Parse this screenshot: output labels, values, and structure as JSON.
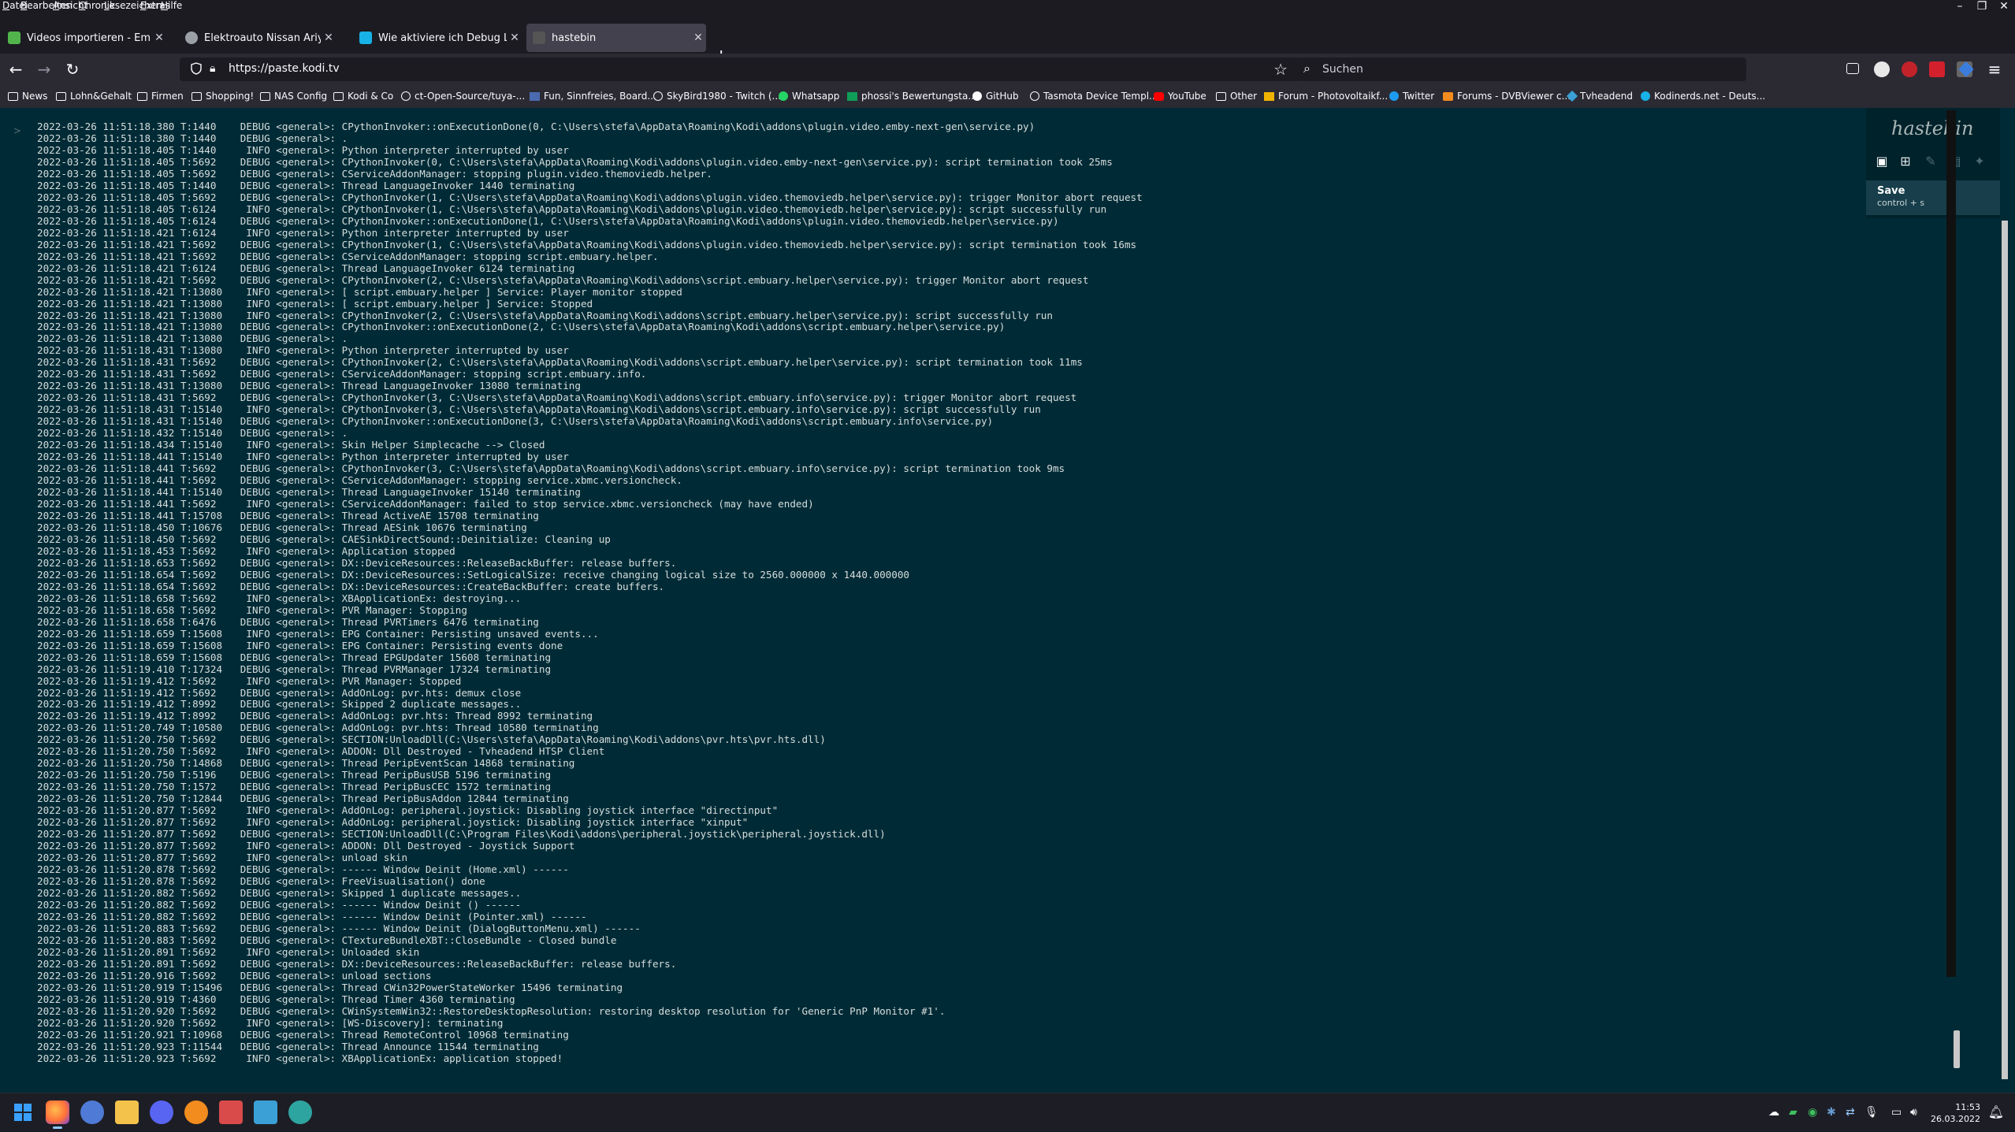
{
  "menubar": {
    "items": [
      "Datei",
      "Bearbeiten",
      "Ansicht",
      "Chronik",
      "Lesezeichen",
      "Extras",
      "Hilfe"
    ]
  },
  "tabs": [
    {
      "label": "Videos importieren - Emby in K...",
      "active": false,
      "icon": "emby-favicon",
      "color": "#52b54b"
    },
    {
      "label": "Elektroauto Nissan Ariya im erst...",
      "active": false,
      "icon": "globe-favicon",
      "color": "#9aa0a6"
    },
    {
      "label": "Wie aktiviere ich Debug Logging...",
      "active": false,
      "icon": "kodi-favicon",
      "color": "#17b2e7"
    },
    {
      "label": "hastebin",
      "active": true,
      "icon": "hastebin-favicon",
      "color": "#555"
    }
  ],
  "nav": {
    "url": "https://paste.kodi.tv",
    "search_placeholder": "Suchen"
  },
  "bookmarks": [
    {
      "label": "News",
      "icon": "folder-icon"
    },
    {
      "label": "Lohn&Gehalt",
      "icon": "folder-icon"
    },
    {
      "label": "Firmen",
      "icon": "folder-icon"
    },
    {
      "label": "Shopping!",
      "icon": "folder-icon"
    },
    {
      "label": "NAS Config",
      "icon": "folder-icon"
    },
    {
      "label": "Kodi & Co",
      "icon": "folder-icon"
    },
    {
      "label": "ct-Open-Source/tuya-...",
      "icon": "globe-icon"
    },
    {
      "label": "Fun, Sinnfreies, Board...",
      "icon": "site-icon"
    },
    {
      "label": "SkyBird1980 - Twitch (...",
      "icon": "globe-icon"
    },
    {
      "label": "Whatsapp",
      "icon": "whatsapp-icon"
    },
    {
      "label": "phossi's Bewertungsta...",
      "icon": "sheet-icon"
    },
    {
      "label": "GitHub",
      "icon": "github-icon"
    },
    {
      "label": "Tasmota Device Templ...",
      "icon": "globe-icon"
    },
    {
      "label": "YouTube",
      "icon": "youtube-icon"
    },
    {
      "label": "Other",
      "icon": "folder-icon"
    },
    {
      "label": "Forum - Photovoltaikf...",
      "icon": "site-icon"
    },
    {
      "label": "Twitter",
      "icon": "twitter-icon"
    },
    {
      "label": "Forums - DVBViewer c...",
      "icon": "rss-icon"
    },
    {
      "label": "Tvheadend",
      "icon": "site-icon"
    },
    {
      "label": "Kodinerds.net - Deuts...",
      "icon": "kodi-icon"
    }
  ],
  "hastebin": {
    "logo": "hastebin",
    "tooltip_title": "Save",
    "tooltip_shortcut": "control + s"
  },
  "gutter_marker": ">",
  "log_lines": [
    "2022-03-26 11:51:18.380 T:1440    DEBUG <general>: CPythonInvoker::onExecutionDone(0, C:\\Users\\stefa\\AppData\\Roaming\\Kodi\\addons\\plugin.video.emby-next-gen\\service.py)",
    "2022-03-26 11:51:18.380 T:1440    DEBUG <general>: .",
    "2022-03-26 11:51:18.405 T:1440     INFO <general>: Python interpreter interrupted by user",
    "2022-03-26 11:51:18.405 T:5692    DEBUG <general>: CPythonInvoker(0, C:\\Users\\stefa\\AppData\\Roaming\\Kodi\\addons\\plugin.video.emby-next-gen\\service.py): script termination took 25ms",
    "2022-03-26 11:51:18.405 T:5692    DEBUG <general>: CServiceAddonManager: stopping plugin.video.themoviedb.helper.",
    "2022-03-26 11:51:18.405 T:1440    DEBUG <general>: Thread LanguageInvoker 1440 terminating",
    "2022-03-26 11:51:18.405 T:5692    DEBUG <general>: CPythonInvoker(1, C:\\Users\\stefa\\AppData\\Roaming\\Kodi\\addons\\plugin.video.themoviedb.helper\\service.py): trigger Monitor abort request",
    "2022-03-26 11:51:18.405 T:6124     INFO <general>: CPythonInvoker(1, C:\\Users\\stefa\\AppData\\Roaming\\Kodi\\addons\\plugin.video.themoviedb.helper\\service.py): script successfully run",
    "2022-03-26 11:51:18.405 T:6124    DEBUG <general>: CPythonInvoker::onExecutionDone(1, C:\\Users\\stefa\\AppData\\Roaming\\Kodi\\addons\\plugin.video.themoviedb.helper\\service.py)",
    "2022-03-26 11:51:18.421 T:6124     INFO <general>: Python interpreter interrupted by user",
    "2022-03-26 11:51:18.421 T:5692    DEBUG <general>: CPythonInvoker(1, C:\\Users\\stefa\\AppData\\Roaming\\Kodi\\addons\\plugin.video.themoviedb.helper\\service.py): script termination took 16ms",
    "2022-03-26 11:51:18.421 T:5692    DEBUG <general>: CServiceAddonManager: stopping script.embuary.helper.",
    "2022-03-26 11:51:18.421 T:6124    DEBUG <general>: Thread LanguageInvoker 6124 terminating",
    "2022-03-26 11:51:18.421 T:5692    DEBUG <general>: CPythonInvoker(2, C:\\Users\\stefa\\AppData\\Roaming\\Kodi\\addons\\script.embuary.helper\\service.py): trigger Monitor abort request",
    "2022-03-26 11:51:18.421 T:13080    INFO <general>: [ script.embuary.helper ] Service: Player monitor stopped",
    "2022-03-26 11:51:18.421 T:13080    INFO <general>: [ script.embuary.helper ] Service: Stopped",
    "2022-03-26 11:51:18.421 T:13080    INFO <general>: CPythonInvoker(2, C:\\Users\\stefa\\AppData\\Roaming\\Kodi\\addons\\script.embuary.helper\\service.py): script successfully run",
    "2022-03-26 11:51:18.421 T:13080   DEBUG <general>: CPythonInvoker::onExecutionDone(2, C:\\Users\\stefa\\AppData\\Roaming\\Kodi\\addons\\script.embuary.helper\\service.py)",
    "2022-03-26 11:51:18.421 T:13080   DEBUG <general>: .",
    "2022-03-26 11:51:18.431 T:13080    INFO <general>: Python interpreter interrupted by user",
    "2022-03-26 11:51:18.431 T:5692    DEBUG <general>: CPythonInvoker(2, C:\\Users\\stefa\\AppData\\Roaming\\Kodi\\addons\\script.embuary.helper\\service.py): script termination took 11ms",
    "2022-03-26 11:51:18.431 T:5692    DEBUG <general>: CServiceAddonManager: stopping script.embuary.info.",
    "2022-03-26 11:51:18.431 T:13080   DEBUG <general>: Thread LanguageInvoker 13080 terminating",
    "2022-03-26 11:51:18.431 T:5692    DEBUG <general>: CPythonInvoker(3, C:\\Users\\stefa\\AppData\\Roaming\\Kodi\\addons\\script.embuary.info\\service.py): trigger Monitor abort request",
    "2022-03-26 11:51:18.431 T:15140    INFO <general>: CPythonInvoker(3, C:\\Users\\stefa\\AppData\\Roaming\\Kodi\\addons\\script.embuary.info\\service.py): script successfully run",
    "2022-03-26 11:51:18.431 T:15140   DEBUG <general>: CPythonInvoker::onExecutionDone(3, C:\\Users\\stefa\\AppData\\Roaming\\Kodi\\addons\\script.embuary.info\\service.py)",
    "2022-03-26 11:51:18.432 T:15140   DEBUG <general>: .",
    "2022-03-26 11:51:18.434 T:15140    INFO <general>: Skin Helper Simplecache --> Closed",
    "2022-03-26 11:51:18.441 T:15140    INFO <general>: Python interpreter interrupted by user",
    "2022-03-26 11:51:18.441 T:5692    DEBUG <general>: CPythonInvoker(3, C:\\Users\\stefa\\AppData\\Roaming\\Kodi\\addons\\script.embuary.info\\service.py): script termination took 9ms",
    "2022-03-26 11:51:18.441 T:5692    DEBUG <general>: CServiceAddonManager: stopping service.xbmc.versioncheck.",
    "2022-03-26 11:51:18.441 T:15140   DEBUG <general>: Thread LanguageInvoker 15140 terminating",
    "2022-03-26 11:51:18.441 T:5692     INFO <general>: CServiceAddonManager: failed to stop service.xbmc.versioncheck (may have ended)",
    "2022-03-26 11:51:18.441 T:15708   DEBUG <general>: Thread ActiveAE 15708 terminating",
    "2022-03-26 11:51:18.450 T:10676   DEBUG <general>: Thread AESink 10676 terminating",
    "2022-03-26 11:51:18.450 T:5692    DEBUG <general>: CAESinkDirectSound::Deinitialize: Cleaning up",
    "2022-03-26 11:51:18.453 T:5692     INFO <general>: Application stopped",
    "2022-03-26 11:51:18.653 T:5692    DEBUG <general>: DX::DeviceResources::ReleaseBackBuffer: release buffers.",
    "2022-03-26 11:51:18.654 T:5692    DEBUG <general>: DX::DeviceResources::SetLogicalSize: receive changing logical size to 2560.000000 x 1440.000000",
    "2022-03-26 11:51:18.654 T:5692    DEBUG <general>: DX::DeviceResources::CreateBackBuffer: create buffers.",
    "2022-03-26 11:51:18.658 T:5692     INFO <general>: XBApplicationEx: destroying...",
    "2022-03-26 11:51:18.658 T:5692     INFO <general>: PVR Manager: Stopping",
    "2022-03-26 11:51:18.658 T:6476    DEBUG <general>: Thread PVRTimers 6476 terminating",
    "2022-03-26 11:51:18.659 T:15608    INFO <general>: EPG Container: Persisting unsaved events...",
    "2022-03-26 11:51:18.659 T:15608    INFO <general>: EPG Container: Persisting events done",
    "2022-03-26 11:51:18.659 T:15608   DEBUG <general>: Thread EPGUpdater 15608 terminating",
    "2022-03-26 11:51:19.410 T:17324   DEBUG <general>: Thread PVRManager 17324 terminating",
    "2022-03-26 11:51:19.412 T:5692     INFO <general>: PVR Manager: Stopped",
    "2022-03-26 11:51:19.412 T:5692    DEBUG <general>: AddOnLog: pvr.hts: demux close",
    "2022-03-26 11:51:19.412 T:8992    DEBUG <general>: Skipped 2 duplicate messages..",
    "2022-03-26 11:51:19.412 T:8992    DEBUG <general>: AddOnLog: pvr.hts: Thread 8992 terminating",
    "2022-03-26 11:51:20.749 T:10580   DEBUG <general>: AddOnLog: pvr.hts: Thread 10580 terminating",
    "2022-03-26 11:51:20.750 T:5692    DEBUG <general>: SECTION:UnloadDll(C:\\Users\\stefa\\AppData\\Roaming\\Kodi\\addons\\pvr.hts\\pvr.hts.dll)",
    "2022-03-26 11:51:20.750 T:5692     INFO <general>: ADDON: Dll Destroyed - Tvheadend HTSP Client",
    "2022-03-26 11:51:20.750 T:14868   DEBUG <general>: Thread PeripEventScan 14868 terminating",
    "2022-03-26 11:51:20.750 T:5196    DEBUG <general>: Thread PeripBusUSB 5196 terminating",
    "2022-03-26 11:51:20.750 T:1572    DEBUG <general>: Thread PeripBusCEC 1572 terminating",
    "2022-03-26 11:51:20.750 T:12844   DEBUG <general>: Thread PeripBusAddon 12844 terminating",
    "2022-03-26 11:51:20.877 T:5692     INFO <general>: AddOnLog: peripheral.joystick: Disabling joystick interface \"directinput\"",
    "2022-03-26 11:51:20.877 T:5692     INFO <general>: AddOnLog: peripheral.joystick: Disabling joystick interface \"xinput\"",
    "2022-03-26 11:51:20.877 T:5692    DEBUG <general>: SECTION:UnloadDll(C:\\Program Files\\Kodi\\addons\\peripheral.joystick\\peripheral.joystick.dll)",
    "2022-03-26 11:51:20.877 T:5692     INFO <general>: ADDON: Dll Destroyed - Joystick Support",
    "2022-03-26 11:51:20.877 T:5692     INFO <general>: unload skin",
    "2022-03-26 11:51:20.878 T:5692    DEBUG <general>: ------ Window Deinit (Home.xml) ------",
    "2022-03-26 11:51:20.878 T:5692    DEBUG <general>: FreeVisualisation() done",
    "2022-03-26 11:51:20.882 T:5692    DEBUG <general>: Skipped 1 duplicate messages..",
    "2022-03-26 11:51:20.882 T:5692    DEBUG <general>: ------ Window Deinit () ------",
    "2022-03-26 11:51:20.882 T:5692    DEBUG <general>: ------ Window Deinit (Pointer.xml) ------",
    "2022-03-26 11:51:20.883 T:5692    DEBUG <general>: ------ Window Deinit (DialogButtonMenu.xml) ------",
    "2022-03-26 11:51:20.883 T:5692    DEBUG <general>: CTextureBundleXBT::CloseBundle - Closed bundle",
    "2022-03-26 11:51:20.891 T:5692     INFO <general>: Unloaded skin",
    "2022-03-26 11:51:20.891 T:5692    DEBUG <general>: DX::DeviceResources::ReleaseBackBuffer: release buffers.",
    "2022-03-26 11:51:20.916 T:5692    DEBUG <general>: unload sections",
    "2022-03-26 11:51:20.919 T:15496   DEBUG <general>: Thread CWin32PowerStateWorker 15496 terminating",
    "2022-03-26 11:51:20.919 T:4360    DEBUG <general>: Thread Timer 4360 terminating",
    "2022-03-26 11:51:20.920 T:5692    DEBUG <general>: CWinSystemWin32::RestoreDesktopResolution: restoring desktop resolution for 'Generic PnP Monitor #1'.",
    "2022-03-26 11:51:20.920 T:5692     INFO <general>: [WS-Discovery]: terminating",
    "2022-03-26 11:51:20.921 T:10968   DEBUG <general>: Thread RemoteControl 10968 terminating",
    "2022-03-26 11:51:20.923 T:11544   DEBUG <general>: Thread Announce 11544 terminating",
    "2022-03-26 11:51:20.923 T:5692     INFO <general>: XBApplicationEx: application stopped!"
  ],
  "taskbar": {
    "time": "11:53",
    "date": "26.03.2022",
    "apps": [
      {
        "name": "start-icon",
        "color": "#3aa0ff"
      },
      {
        "name": "firefox-icon",
        "color": "#ff7139"
      },
      {
        "name": "chat-icon",
        "color": "#4f7ad6"
      },
      {
        "name": "explorer-icon",
        "color": "#f3c24b"
      },
      {
        "name": "discord-icon",
        "color": "#5865f2"
      },
      {
        "name": "crossout-icon",
        "color": "#f28c1e"
      },
      {
        "name": "calendar-icon",
        "color": "#d94b4b"
      },
      {
        "name": "notes-icon",
        "color": "#3aa0d6"
      },
      {
        "name": "globe-app-icon",
        "color": "#2ea4a0"
      }
    ]
  }
}
